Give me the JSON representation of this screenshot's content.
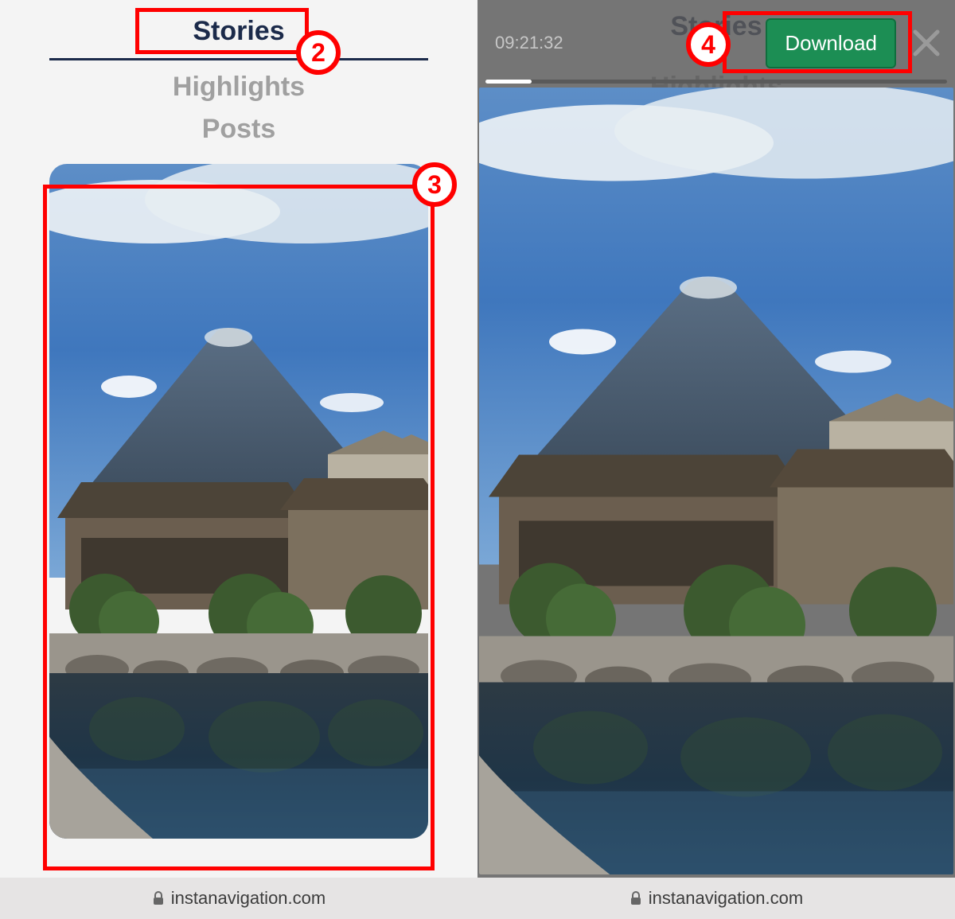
{
  "left": {
    "tabs": {
      "stories": "Stories",
      "highlights": "Highlights",
      "posts": "Posts"
    },
    "url": "instanavigation.com"
  },
  "right": {
    "bg_tab_stories": "Stories",
    "bg_tab_highlights": "Highlights",
    "timestamp": "09:21:32",
    "download_label": "Download",
    "url": "instanavigation.com",
    "progress_percent": 10
  },
  "annotations": {
    "step2": "2",
    "step3": "3",
    "step4": "4"
  },
  "colors": {
    "accent": "#1b2a4a",
    "download_green": "#1c8e54",
    "annotation_red": "#ff0000"
  }
}
